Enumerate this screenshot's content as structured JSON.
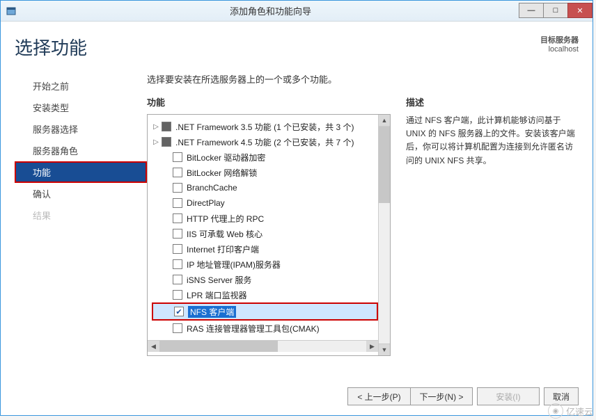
{
  "titlebar": {
    "title": "添加角色和功能向导"
  },
  "header": {
    "page_title": "选择功能",
    "target_label": "目标服务器",
    "target_value": "localhost"
  },
  "sidebar": {
    "items": [
      {
        "label": "开始之前",
        "state": "normal"
      },
      {
        "label": "安装类型",
        "state": "normal"
      },
      {
        "label": "服务器选择",
        "state": "normal"
      },
      {
        "label": "服务器角色",
        "state": "normal"
      },
      {
        "label": "功能",
        "state": "active"
      },
      {
        "label": "确认",
        "state": "normal"
      },
      {
        "label": "结果",
        "state": "disabled"
      }
    ]
  },
  "main": {
    "instruction": "选择要安装在所选服务器上的一个或多个功能。",
    "features_label": "功能",
    "description_label": "描述",
    "description_text": "通过 NFS 客户端，此计算机能够访问基于 UNIX 的 NFS 服务器上的文件。安装该客户端后，你可以将计算机配置为连接到允许匿名访问的 UNIX NFS 共享。",
    "tree": [
      {
        "label": ".NET Framework 3.5 功能 (1 个已安装，共 3 个)",
        "expander": "▷",
        "check": "ind"
      },
      {
        "label": ".NET Framework 4.5 功能 (2 个已安装，共 7 个)",
        "expander": "▷",
        "check": "ind"
      },
      {
        "label": "BitLocker 驱动器加密",
        "expander": "",
        "check": ""
      },
      {
        "label": "BitLocker 网络解锁",
        "expander": "",
        "check": ""
      },
      {
        "label": "BranchCache",
        "expander": "",
        "check": ""
      },
      {
        "label": "DirectPlay",
        "expander": "",
        "check": ""
      },
      {
        "label": "HTTP 代理上的 RPC",
        "expander": "",
        "check": ""
      },
      {
        "label": "IIS 可承载 Web 核心",
        "expander": "",
        "check": ""
      },
      {
        "label": "Internet 打印客户端",
        "expander": "",
        "check": ""
      },
      {
        "label": "IP 地址管理(IPAM)服务器",
        "expander": "",
        "check": ""
      },
      {
        "label": "iSNS Server 服务",
        "expander": "",
        "check": ""
      },
      {
        "label": "LPR 端口监视器",
        "expander": "",
        "check": ""
      },
      {
        "label": "NFS 客户端",
        "expander": "",
        "check": "checked",
        "selected": true,
        "highlight": true
      },
      {
        "label": "RAS 连接管理器管理工具包(CMAK)",
        "expander": "",
        "check": ""
      }
    ]
  },
  "footer": {
    "prev": "< 上一步(P)",
    "next": "下一步(N) >",
    "install": "安装(I)",
    "cancel": "取消"
  },
  "watermark": "亿速云"
}
